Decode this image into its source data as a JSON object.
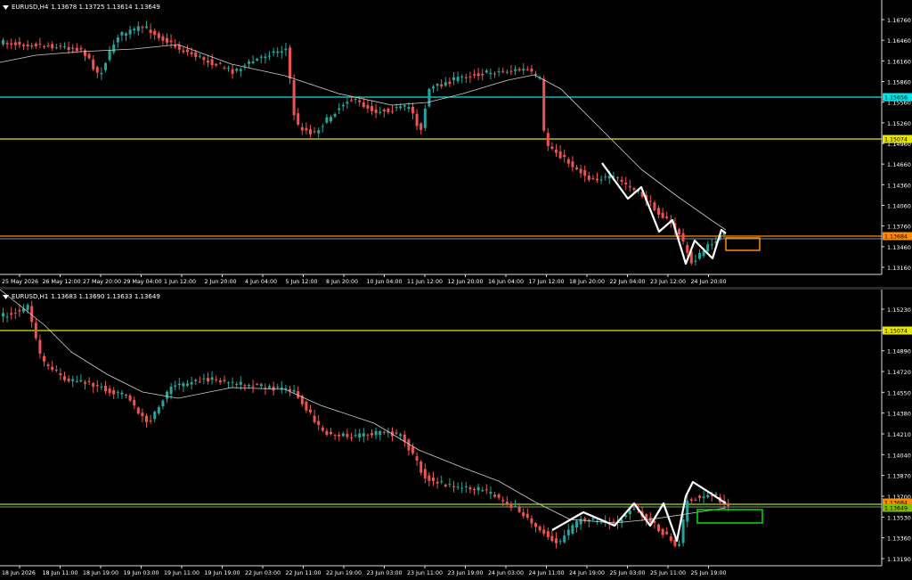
{
  "colors": {
    "bull": "#26a69a",
    "bear": "#ef5350",
    "cyan": "#00e5e5",
    "yellow": "#e6e600",
    "orange": "#ff8c00",
    "lime": "#7fbf00",
    "green": "#00e000",
    "ma": "#cfcfcf",
    "zigzag": "#ffffff",
    "axis": "#dddddd",
    "text": "#ffffff"
  },
  "top": {
    "symbol": "EURUSD,H4",
    "ohlc": "1.13678 1.13725 1.13614 1.13649",
    "price_labels": [
      "1.16760",
      "1.16460",
      "1.16160",
      "1.15860",
      "1.15560",
      "1.15260",
      "1.14960",
      "1.14660",
      "1.14360",
      "1.14060",
      "1.13760",
      "1.13460",
      "1.13160"
    ],
    "tags": {
      "cyan": "1.15656",
      "yellow": "1.15074",
      "orange": "1.13684"
    },
    "time_labels": [
      "25 May 2026",
      "26 May 12:00",
      "27 May 20:00",
      "29 May 04:00",
      "1 Jun 12:00",
      "2 Jun 20:00",
      "4 Jun 04:00",
      "5 Jun 12:00",
      "8 Jun 20:00",
      "10 Jun 04:00",
      "11 Jun 12:00",
      "12 Jun 20:00",
      "16 Jun 04:00",
      "17 Jun 12:00",
      "18 Jun 20:00",
      "22 Jun 04:00",
      "23 Jun 12:00",
      "24 Jun 20:00"
    ]
  },
  "bottom": {
    "symbol": "EURUSD,H1",
    "ohlc": "1.13683 1.13690 1.13633 1.13649",
    "price_labels": [
      "1.15230",
      "1.15060",
      "1.14890",
      "1.14720",
      "1.14550",
      "1.14380",
      "1.14210",
      "1.14040",
      "1.13870",
      "1.13700",
      "1.13530",
      "1.13360",
      "1.13190"
    ],
    "tags": {
      "yellow": "1.15074",
      "orange": "1.13684",
      "lower": "1.13649"
    },
    "time_labels": [
      "18 Jun 2026",
      "18 Jun 11:00",
      "18 Jun 19:00",
      "19 Jun 03:00",
      "19 Jun 11:00",
      "19 Jun 19:00",
      "22 Jun 03:00",
      "22 Jun 11:00",
      "22 Jun 19:00",
      "23 Jun 03:00",
      "23 Jun 11:00",
      "23 Jun 19:00",
      "24 Jun 03:00",
      "24 Jun 11:00",
      "24 Jun 19:00",
      "25 Jun 03:00",
      "25 Jun 11:00",
      "25 Jun 19:00"
    ]
  }
}
